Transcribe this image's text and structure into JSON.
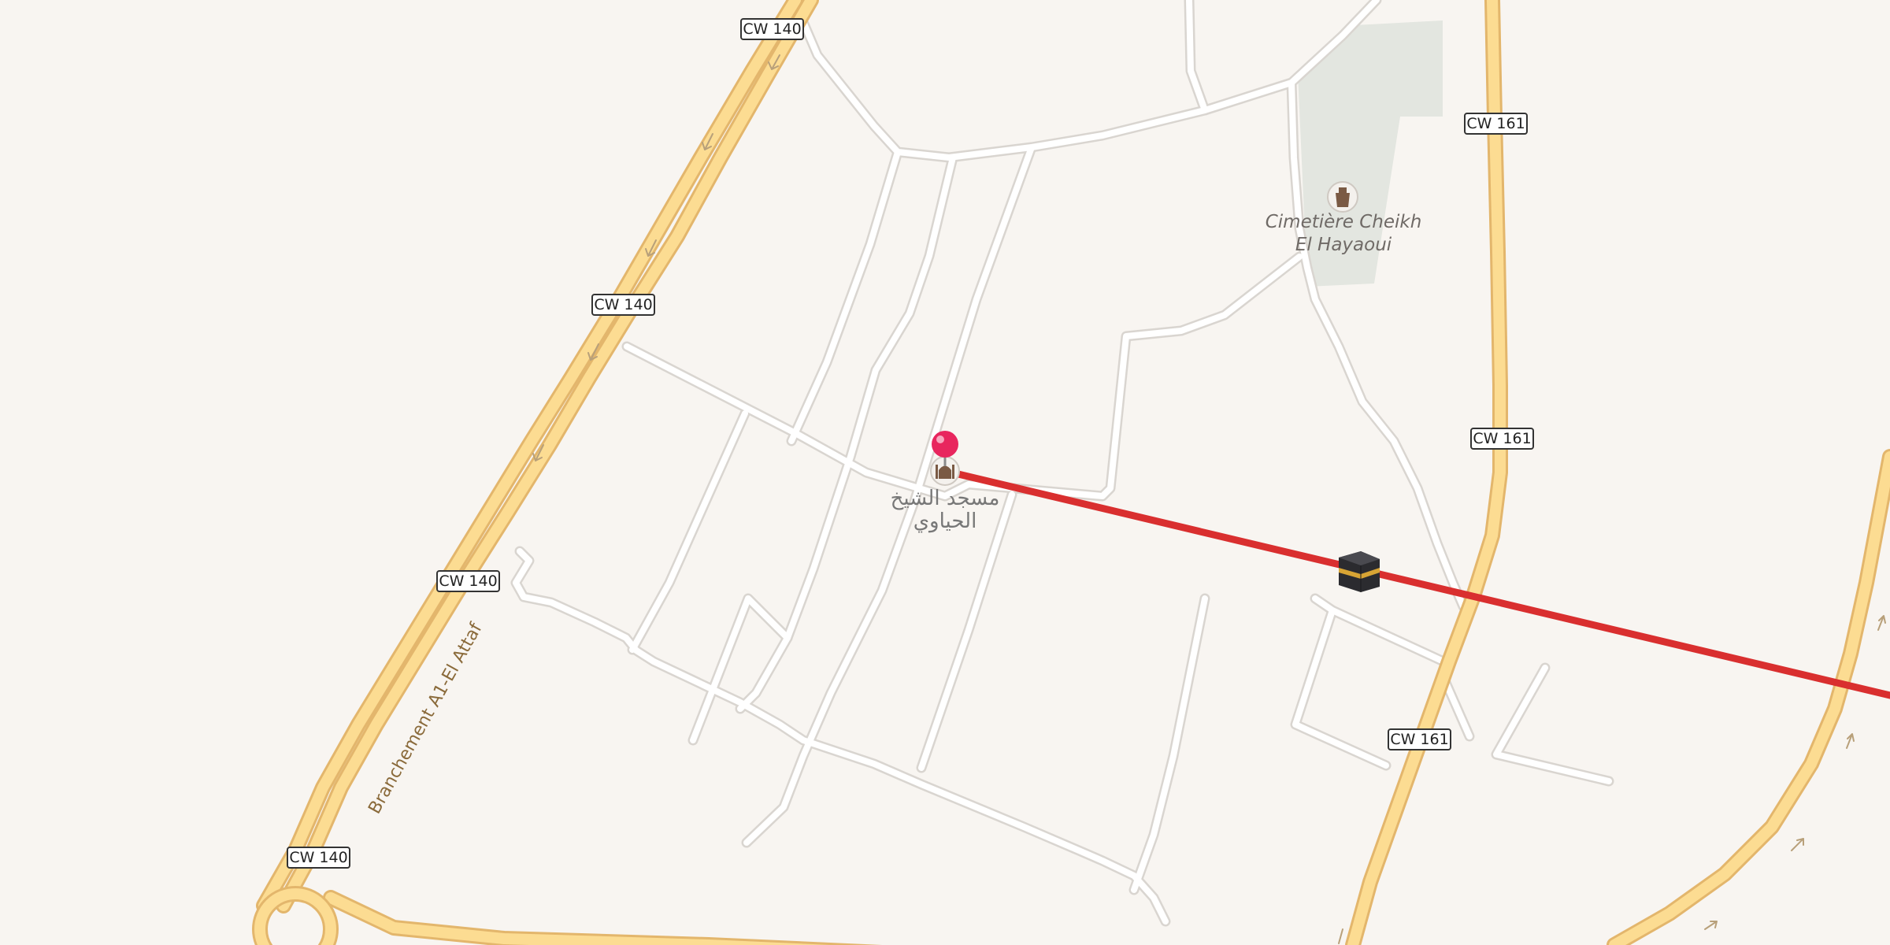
{
  "map": {
    "colors": {
      "background": "#f8f5f1",
      "major_road_fill": "#fcdc92",
      "major_road_casing": "#e3b66c",
      "minor_road_fill": "#ffffff",
      "minor_road_casing": "#d9d5d0",
      "cemetery_fill": "#e3e6e0",
      "qibla_line": "#d92f2f",
      "pin": "#e8265e"
    },
    "shields": [
      {
        "id": "cw140-a",
        "text": "CW 140"
      },
      {
        "id": "cw140-b",
        "text": "CW 140"
      },
      {
        "id": "cw140-c",
        "text": "CW 140"
      },
      {
        "id": "cw140-d",
        "text": "CW 140"
      },
      {
        "id": "cw161-a",
        "text": "CW 161"
      },
      {
        "id": "cw161-b",
        "text": "CW 161"
      },
      {
        "id": "cw161-c",
        "text": "CW 161"
      }
    ],
    "road_names": {
      "branchement": "Branchement A1-El Attaf"
    },
    "pois": {
      "cemetery": {
        "line1": "Cimetière Cheikh",
        "line2": "El Hayaoui",
        "icon": "cemetery-icon"
      },
      "mosque": {
        "line1": "مسجد الشيخ",
        "line2": "الحياوي",
        "icon": "mosque-icon"
      }
    },
    "markers": {
      "pin": {
        "icon": "map-pin-icon"
      },
      "kaaba": {
        "icon": "kaaba-icon"
      }
    }
  }
}
